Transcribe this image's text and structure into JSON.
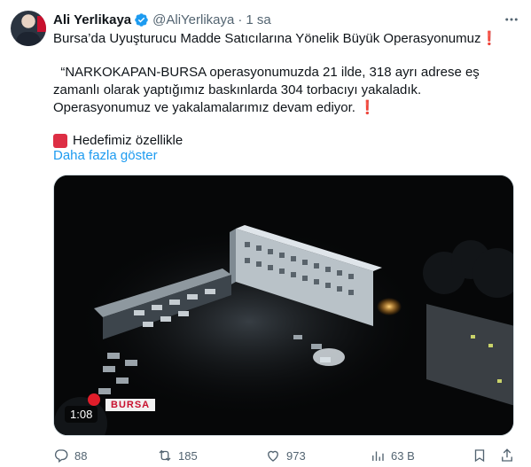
{
  "author": {
    "name": "Ali Yerlikaya",
    "handle": "@AliYerlikaya",
    "separator": "·",
    "time": "1 sa",
    "verified_icon": "verified-badge-icon"
  },
  "tweet": {
    "line1": "Bursa’da Uyuşturucu Madde Satıcılarına Yönelik Büyük Operasyonumuz",
    "exclamation": "❗",
    "quote": "“NARKOKAPAN-BURSA operasyonumuzda 21 ilde, 318 ayrı adrese eş zamanlı olarak yaptığımız baskınlarda 304 torbacıyı yakaladık. Operasyonumuz ve yakalamalarımız devam ediyor.",
    "target": "Hedefimiz özellikle",
    "show_more": "Daha fazla göster"
  },
  "media": {
    "duration": "1:08",
    "location_banner": "BURSA"
  },
  "actions": {
    "replies": "88",
    "retweets": "185",
    "likes": "973",
    "views": "63 B"
  },
  "colors": {
    "link": "#1d9bf0",
    "verified": "#1d9bf0",
    "secondary_text": "#536471",
    "alert_red": "#dd2e44"
  }
}
